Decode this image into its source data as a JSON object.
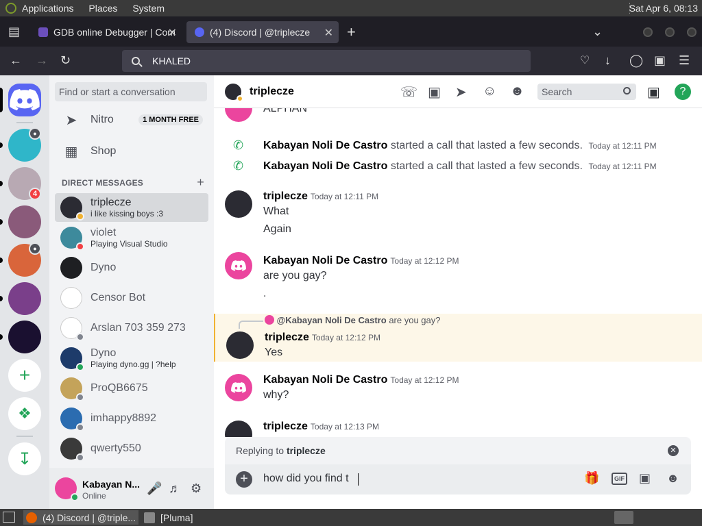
{
  "os_panel": {
    "menus": [
      "Applications",
      "Places",
      "System"
    ],
    "clock": "Sat Apr  6, 08:13"
  },
  "browser": {
    "tabs": [
      {
        "title": "GDB online Debugger | Com",
        "active": false
      },
      {
        "title": "(4) Discord | @triplecze",
        "active": true
      }
    ],
    "url": "KHALED"
  },
  "discord": {
    "guild_badge": "4",
    "sidebar": {
      "search_placeholder": "Find or start a conversation",
      "nitro_label": "Nitro",
      "nitro_badge": "1 MONTH FREE",
      "shop_label": "Shop",
      "dm_header": "DIRECT MESSAGES",
      "dms": [
        {
          "name": "triplecze",
          "sub": "i like kissing boys :3",
          "active": true,
          "status": "idle",
          "color": "#2b2b33"
        },
        {
          "name": "violet",
          "sub": "Playing Visual Studio",
          "active": false,
          "status": "dnd",
          "color": "#3d8a9c"
        },
        {
          "name": "Dyno",
          "sub": "",
          "active": false,
          "status": "none",
          "color": "#1e1f22"
        },
        {
          "name": "Censor Bot",
          "sub": "",
          "active": false,
          "status": "none",
          "color": "#ffffff"
        },
        {
          "name": "Arslan 703 359 273",
          "sub": "",
          "active": false,
          "status": "offline",
          "color": "#ffffff"
        },
        {
          "name": "Dyno",
          "sub": "Playing dyno.gg | ?help",
          "active": false,
          "status": "online",
          "color": "#1d3b6a"
        },
        {
          "name": "ProQB6675",
          "sub": "",
          "active": false,
          "status": "offline",
          "color": "#c4a35a"
        },
        {
          "name": "imhappy8892",
          "sub": "",
          "active": false,
          "status": "offline",
          "color": "#2b6cb0"
        },
        {
          "name": "qwerty550",
          "sub": "",
          "active": false,
          "status": "offline",
          "color": "#3a3a3a"
        }
      ]
    },
    "user_panel": {
      "name": "Kabayan N...",
      "status": "Online"
    },
    "channel": {
      "name": "triplecze",
      "search_placeholder": "Search"
    },
    "messages": {
      "top_partial": "ALPHAN",
      "calls": [
        {
          "author": "Kabayan Noli De Castro",
          "text": "started a call that lasted a few seconds.",
          "time": "Today at 12:11 PM"
        },
        {
          "author": "Kabayan Noli De Castro",
          "text": "started a call that lasted a few seconds.",
          "time": "Today at 12:11 PM"
        }
      ],
      "groups": [
        {
          "author": "triplecze",
          "time": "Today at 12:11 PM",
          "lines": [
            "What",
            "Again"
          ]
        },
        {
          "author": "Kabayan Noli De Castro",
          "time": "Today at 12:12 PM",
          "lines": [
            "are you gay?",
            "."
          ]
        },
        {
          "author": "triplecze",
          "time": "Today at 12:12 PM",
          "lines": [
            "Yes"
          ],
          "reply": {
            "author": "@Kabayan Noli De Castro",
            "text": "are you gay?"
          }
        },
        {
          "author": "Kabayan Noli De Castro",
          "time": "Today at 12:12 PM",
          "lines": [
            "why?"
          ]
        },
        {
          "author": "triplecze",
          "time": "Today at 12:13 PM",
          "lines": []
        }
      ]
    },
    "composer": {
      "replying_prefix": "Replying to",
      "replying_name": "triplecze",
      "text": "how did you find t",
      "gif_label": "GIF"
    }
  },
  "taskbar": {
    "items": [
      "(4) Discord | @triple...",
      "[Pluma]"
    ]
  },
  "colors": {
    "blurple": "#5865f2",
    "pink": "#eb459e",
    "green": "#23a559",
    "red": "#f23f43"
  }
}
